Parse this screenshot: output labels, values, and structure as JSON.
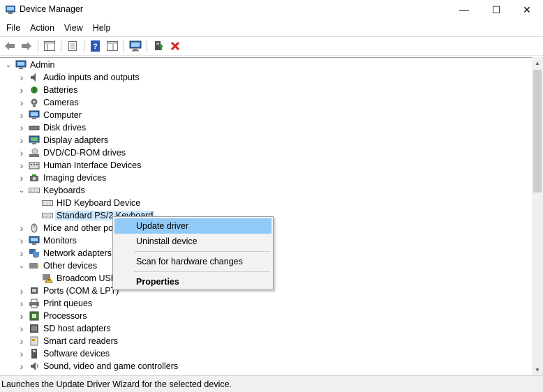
{
  "window": {
    "title": "Device Manager",
    "minimize_glyph": "—",
    "maximize_glyph": "☐",
    "close_glyph": "✕"
  },
  "menu": [
    "File",
    "Action",
    "View",
    "Help"
  ],
  "toolbar": {
    "icons": [
      "back-arrow-icon",
      "forward-arrow-icon",
      "show-hide-console-tree-icon",
      "properties-icon",
      "help-icon",
      "action-pane-icon",
      "computer-monitor-icon",
      "update-driver-icon",
      "uninstall-device-icon"
    ]
  },
  "tree": {
    "root": "Admin",
    "items": [
      {
        "label": "Audio inputs and outputs",
        "icon": "speaker-icon",
        "expanded": false
      },
      {
        "label": "Batteries",
        "icon": "battery-icon",
        "expanded": false
      },
      {
        "label": "Cameras",
        "icon": "camera-icon",
        "expanded": false
      },
      {
        "label": "Computer",
        "icon": "computer-icon",
        "expanded": false
      },
      {
        "label": "Disk drives",
        "icon": "disk-drive-icon",
        "expanded": false
      },
      {
        "label": "Display adapters",
        "icon": "display-adapter-icon",
        "expanded": false
      },
      {
        "label": "DVD/CD-ROM drives",
        "icon": "dvd-drive-icon",
        "expanded": false
      },
      {
        "label": "Human Interface Devices",
        "icon": "hid-icon",
        "expanded": false
      },
      {
        "label": "Imaging devices",
        "icon": "imaging-device-icon",
        "expanded": false
      },
      {
        "label": "Keyboards",
        "icon": "keyboard-icon",
        "expanded": true,
        "children": [
          "HID Keyboard Device",
          "Standard PS/2 Keyboard"
        ]
      },
      {
        "label": "Mice and other po",
        "icon": "mouse-icon",
        "expanded": false
      },
      {
        "label": "Monitors",
        "icon": "monitor-icon",
        "expanded": false
      },
      {
        "label": "Network adapters",
        "icon": "network-adapter-icon",
        "expanded": false
      },
      {
        "label": "Other devices",
        "icon": "other-devices-icon",
        "expanded": true,
        "children": [
          "Broadcom USH"
        ]
      },
      {
        "label": "Ports (COM & LPT)",
        "icon": "port-icon",
        "expanded": false
      },
      {
        "label": "Print queues",
        "icon": "printer-icon",
        "expanded": false
      },
      {
        "label": "Processors",
        "icon": "processor-icon",
        "expanded": false
      },
      {
        "label": "SD host adapters",
        "icon": "sd-host-icon",
        "expanded": false
      },
      {
        "label": "Smart card readers",
        "icon": "smart-card-icon",
        "expanded": false
      },
      {
        "label": "Software devices",
        "icon": "software-device-icon",
        "expanded": false
      },
      {
        "label": "Sound, video and game controllers",
        "icon": "sound-controller-icon",
        "expanded": false
      }
    ],
    "selected": "Standard PS/2 Keyboard"
  },
  "context_menu": {
    "items": [
      "Update driver",
      "Uninstall device",
      "Scan for hardware changes",
      "Properties"
    ],
    "highlighted": "Update driver"
  },
  "status_bar": {
    "text": "Launches the Update Driver Wizard for the selected device."
  },
  "colors": {
    "selection": "#cce8ff",
    "menu_highlight": "#91c9f7",
    "delete_red": "#d32020"
  }
}
